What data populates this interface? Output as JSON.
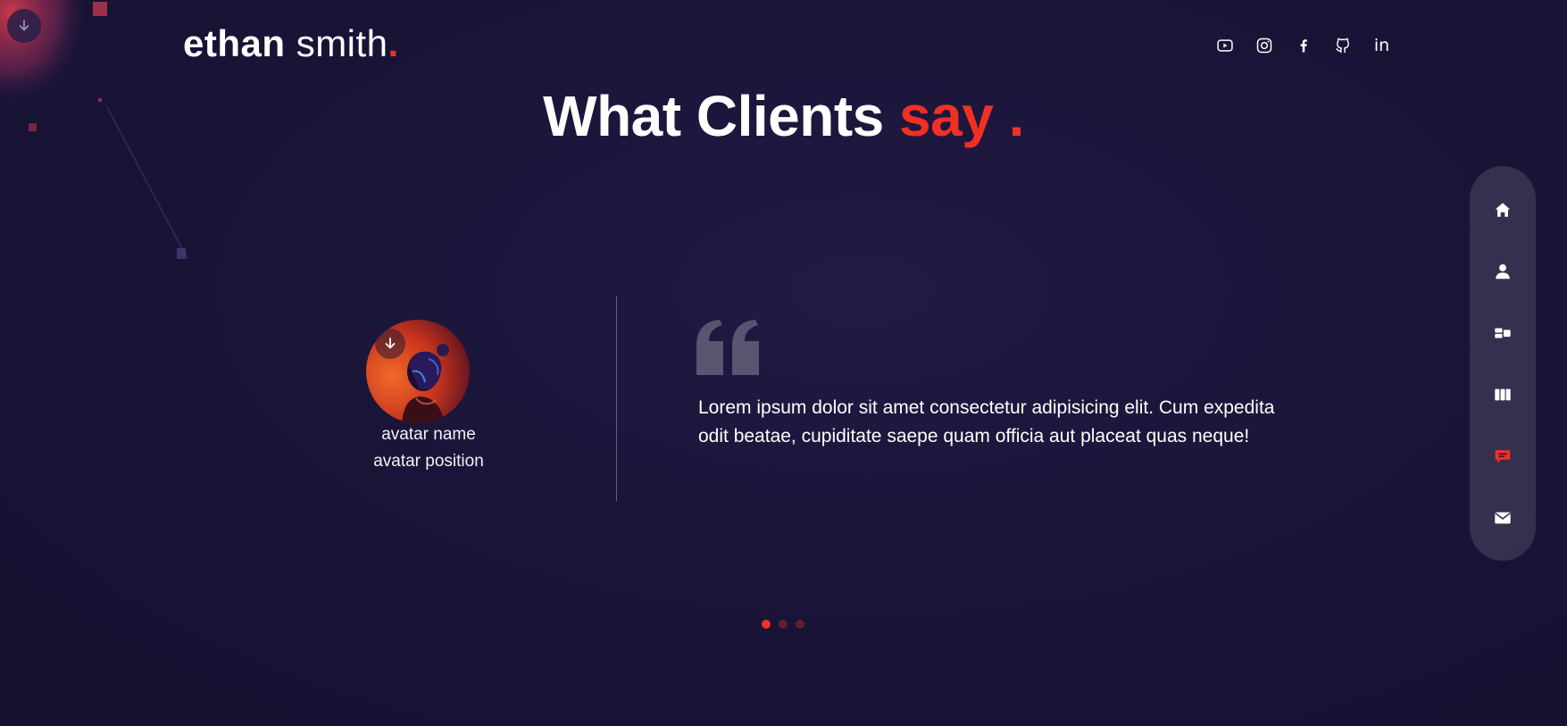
{
  "header": {
    "logo_first": "ethan",
    "logo_last": "smith",
    "logo_dot": "."
  },
  "socials": [
    "youtube-icon",
    "instagram-icon",
    "facebook-icon",
    "github-icon",
    "linkedin-icon"
  ],
  "social_linkedin_text": "in",
  "heading": {
    "main": "What Clients ",
    "accent": "say ."
  },
  "side_nav": {
    "items": [
      "home-icon",
      "user-icon",
      "services-icon",
      "work-icon",
      "testimonials-icon",
      "mail-icon"
    ],
    "active": "testimonials-icon"
  },
  "testimonial": {
    "avatar_name": "avatar name",
    "avatar_position": "avatar position",
    "text": "Lorem ipsum dolor sit amet consectetur adipisicing elit. Cum expedita odit beatae, cupiditate saepe quam officia aut placeat quas neque!"
  },
  "pagination": {
    "total": 3,
    "active_index": 0
  },
  "colors": {
    "accent": "#f13024",
    "background": "#1a1538"
  }
}
